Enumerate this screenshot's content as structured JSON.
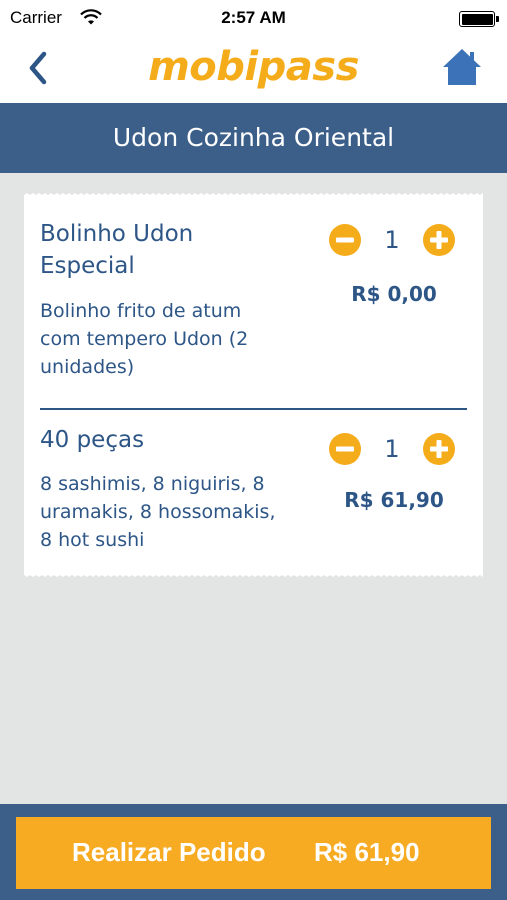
{
  "status_bar": {
    "carrier": "Carrier",
    "time": "2:57 AM",
    "wifi_icon": "wifi-icon",
    "battery_icon": "battery-icon"
  },
  "nav": {
    "back_icon": "chevron-left-icon",
    "logo": "mobipass",
    "home_icon": "home-icon"
  },
  "restaurant": {
    "name": "Udon Cozinha Oriental"
  },
  "items": [
    {
      "name_line1": "Bolinho Udon",
      "name_line2": "Especial",
      "desc_lines": [
        "Bolinho frito de atum",
        "com tempero Udon (2",
        "unidades)"
      ],
      "quantity": "1",
      "price": "R$ 0,00"
    },
    {
      "name_line1": "40 peças",
      "name_line2": "",
      "desc_lines": [
        "8 sashimis, 8 niguiris, 8",
        "uramakis, 8 hossomakis,",
        "8 hot sushi"
      ],
      "quantity": "1",
      "price": "R$ 61,90"
    }
  ],
  "footer": {
    "order_label": "Realizar Pedido",
    "total": "R$ 61,90"
  },
  "colors": {
    "brand_orange": "#f5ac1a",
    "brand_blue": "#3c5f8a",
    "text_blue": "#2d5687",
    "button_orange": "#f7ab23",
    "background": "#e3e5e4"
  }
}
